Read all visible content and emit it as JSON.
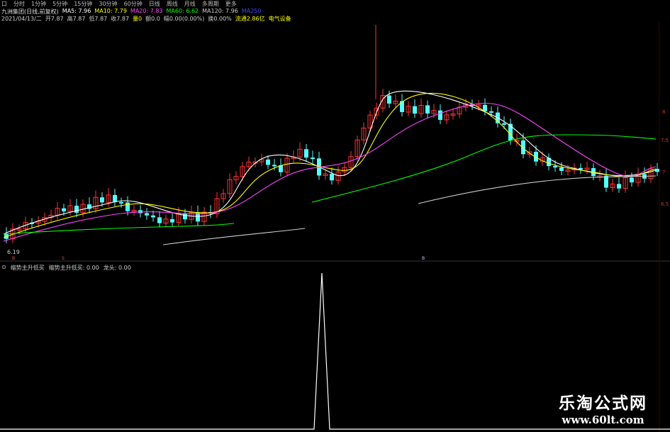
{
  "toolbar": {
    "items": [
      "口",
      "分时",
      "1分钟",
      "5分钟",
      "15分钟",
      "30分钟",
      "60分钟",
      "日线",
      "周线",
      "月线",
      "多周期",
      "更多"
    ]
  },
  "legend": {
    "title": "九洲集团(日线,前复权)",
    "ma5_label": "MA5: 7.96",
    "ma10_label": "MA10: 7.79",
    "ma20_label": "MA20: 7.83",
    "ma60_label": "MA60: 6.62",
    "ma120_label": "MA120: 7.96",
    "ma250_label": "MA250",
    "colors": {
      "ma5": "#ffffff",
      "ma10": "#ffff00",
      "ma20": "#ff44ff",
      "ma60": "#00ff00",
      "ma120": "#cccccc",
      "ma250": "#4444ff"
    }
  },
  "quote": {
    "date": "2021/04/13/二",
    "open": "开7.87",
    "high": "高7.87",
    "low": "低7.87",
    "close": "收7.87",
    "volume": "量0",
    "turnover": "额0.0",
    "change": "幅0.00(0.00%)",
    "rate": "换0.00%",
    "circ": "流通2.86亿",
    "sector": "电气设备"
  },
  "main_chart": {
    "low_price_label": "6.19",
    "right_axis": [
      "8",
      "7.5",
      "7",
      "6.5"
    ],
    "markers": [
      "B",
      "S",
      "B"
    ],
    "candle_colors": {
      "up": "#ff3333",
      "down": "#54ffff"
    }
  },
  "sub_chart": {
    "legend_icon": "⊙",
    "name": "缩势主升低买",
    "value_label": "缩势主升低买: 0.00",
    "dragon_label": "龙头: 0.00",
    "line_color": "#ffffff"
  },
  "watermark": {
    "title": "乐淘公式网",
    "url": "www.60lt.com"
  }
}
